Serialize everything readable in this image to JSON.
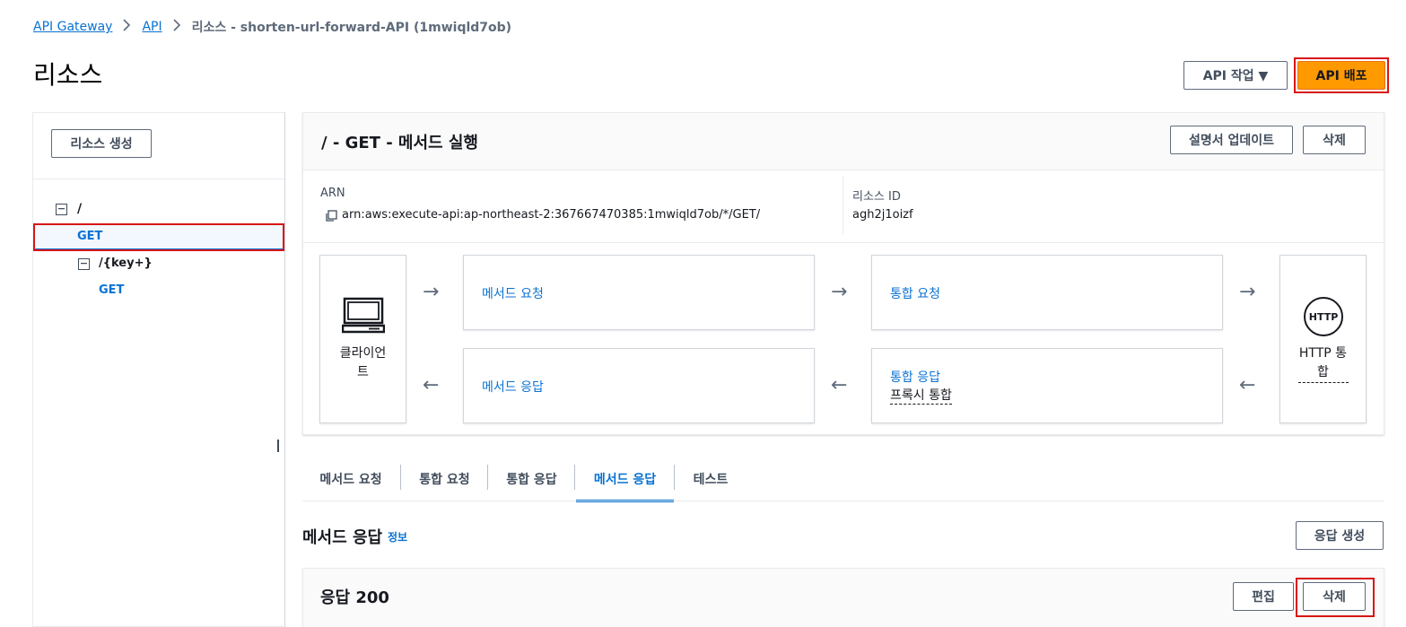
{
  "breadcrumb": {
    "item1": "API Gateway",
    "item2": "API",
    "current": "리소스 - shorten-url-forward-API (1mwiqld7ob)",
    "sep": ">"
  },
  "page": {
    "title": "리소스"
  },
  "header_actions": {
    "api_actions": "API 작업 ▼",
    "deploy": "API 배포"
  },
  "left_panel": {
    "create_resource": "리소스 생성",
    "tree": [
      {
        "label": "/",
        "toggle": "−"
      },
      {
        "label": "GET",
        "selected": true
      },
      {
        "label": "/{key+}",
        "toggle": "−"
      },
      {
        "label": "GET"
      }
    ]
  },
  "method_panel": {
    "title": "/ - GET - 메서드 실행",
    "update_docs": "설명서 업데이트",
    "delete": "삭제",
    "arn_label": "ARN",
    "arn_value": "arn:aws:execute-api:ap-northeast-2:367667470385:1mwiqld7ob/*/GET/",
    "resource_id_label": "리소스 ID",
    "resource_id_value": "agh2j1oizf"
  },
  "flow": {
    "client_line1": "클라이언",
    "client_line2": "트",
    "method_request": "메서드 요청",
    "integration_request": "통합 요청",
    "method_response": "메서드 응답",
    "integration_response": "통합 응답",
    "proxy_integration": "프록시 통합",
    "http_badge": "HTTP",
    "http_line1": "HTTP 통",
    "http_line2": "합",
    "arrow_right": "→",
    "arrow_left": "←"
  },
  "tabs": [
    "메서드 요청",
    "통합 요청",
    "통합 응답",
    "메서드 응답",
    "테스트"
  ],
  "active_tab": "메서드 응답",
  "method_response_section": {
    "title": "메서드 응답",
    "info": "정보",
    "create_response": "응답 생성",
    "response_title": "응답 200",
    "edit": "편집",
    "delete": "삭제"
  },
  "colors": {
    "link": "#0972d3",
    "primary": "#ff9900",
    "highlight": "#d91515"
  },
  "icons": [
    "copy-icon",
    "laptop-icon",
    "http-icon",
    "minus-square-icon",
    "chevron-right-icon"
  ]
}
